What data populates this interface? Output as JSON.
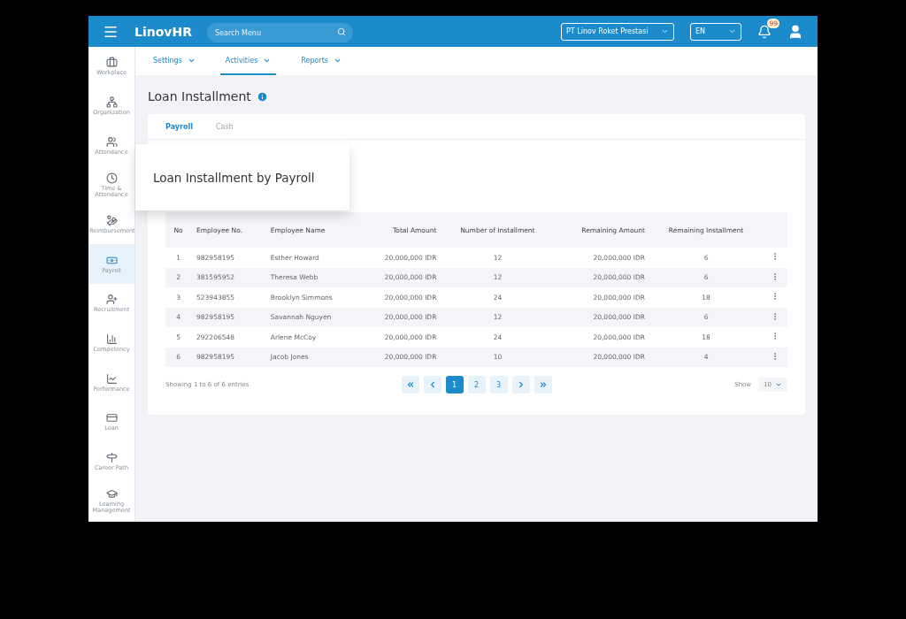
{
  "header": {
    "brand": "LinovHR",
    "search": {
      "placeholder": "Search Menu"
    },
    "company": "PT Linov Roket Prestasi",
    "language": "EN",
    "notification_count": "99"
  },
  "sidebar": {
    "items": [
      {
        "label": "Workplace",
        "selected": false
      },
      {
        "label": "Organization",
        "selected": false
      },
      {
        "label": "Attendance",
        "selected": false
      },
      {
        "label": "Time & Attendance",
        "selected": false
      },
      {
        "label": "Reimbursement",
        "selected": false
      },
      {
        "label": "Payroll",
        "selected": true
      },
      {
        "label": "Recruitment",
        "selected": false
      },
      {
        "label": "Competency",
        "selected": false
      },
      {
        "label": "Performance",
        "selected": false
      },
      {
        "label": "Loan",
        "selected": false
      },
      {
        "label": "Career Path",
        "selected": false
      },
      {
        "label": "Learning Management",
        "selected": false
      }
    ]
  },
  "subnav": [
    {
      "label": "Settings",
      "selected": false
    },
    {
      "label": "Activities",
      "selected": true
    },
    {
      "label": "Reports",
      "selected": false
    }
  ],
  "page_title": "Loan Installment",
  "tabs": [
    {
      "label": "Payroll",
      "selected": true
    },
    {
      "label": "Cash",
      "selected": false
    }
  ],
  "callout": "Loan Installment by Payroll",
  "table": {
    "columns": [
      "No",
      "Employee No.",
      "Employee Name",
      "Total Amount",
      "Number of Installment",
      "Remaining Amount",
      "Remaining Installment"
    ],
    "rows": [
      [
        "1",
        "982958195",
        "Esther Howard",
        "20,000,000 IDR",
        "12",
        "20,000,000 IDR",
        "6"
      ],
      [
        "2",
        "381595952",
        "Theresa Webb",
        "20,000,000 IDR",
        "12",
        "20,000,000 IDR",
        "6"
      ],
      [
        "3",
        "523943855",
        "Brooklyn Simmons",
        "20,000,000 IDR",
        "24",
        "20,000,000 IDR",
        "18"
      ],
      [
        "4",
        "982958195",
        "Savannah Nguyen",
        "20,000,000 IDR",
        "12",
        "20,000,000 IDR",
        "6"
      ],
      [
        "5",
        "292206548",
        "Arlene McCoy",
        "20,000,000 IDR",
        "24",
        "20,000,000 IDR",
        "18"
      ],
      [
        "6",
        "982958195",
        "Jacob Jones",
        "20,000,000 IDR",
        "10",
        "20,000,000 IDR",
        "4"
      ]
    ]
  },
  "footer": {
    "summary": "Showing 1 to 6 of 6 entries",
    "pages": [
      {
        "label": "1",
        "selected": true
      },
      {
        "label": "2",
        "selected": false
      },
      {
        "label": "3",
        "selected": false
      }
    ],
    "show_label": "Show",
    "page_size": "10"
  }
}
